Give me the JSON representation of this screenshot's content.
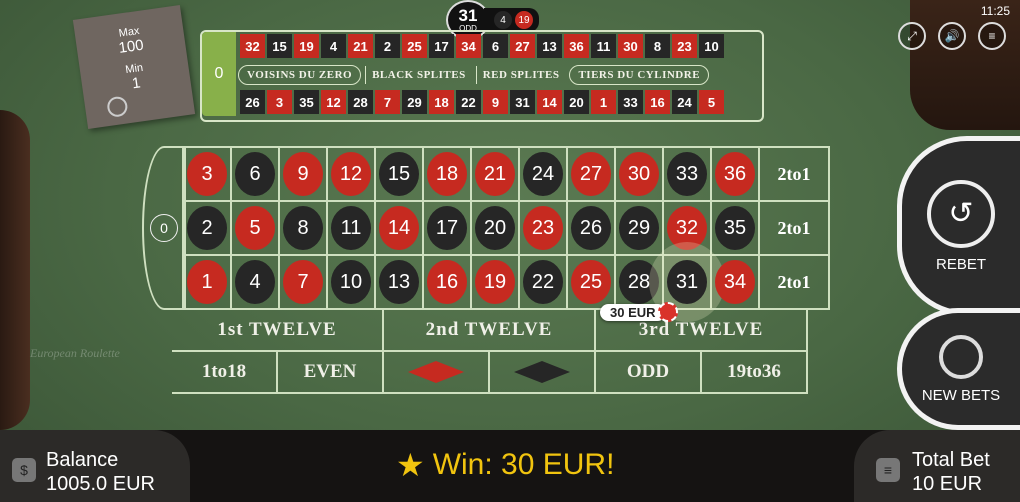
{
  "clock": "11:25",
  "limits": {
    "max_label": "Max",
    "max": "100",
    "min_label": "Min",
    "min": "1"
  },
  "last_result": {
    "number": "31",
    "parity": "ODD",
    "history": [
      {
        "n": "4",
        "c": "blk"
      },
      {
        "n": "19",
        "c": "red"
      }
    ]
  },
  "racetrack": {
    "zero": "0",
    "top": [
      {
        "n": "32",
        "c": "red"
      },
      {
        "n": "15",
        "c": "blk"
      },
      {
        "n": "19",
        "c": "red"
      },
      {
        "n": "4",
        "c": "blk"
      },
      {
        "n": "21",
        "c": "red"
      },
      {
        "n": "2",
        "c": "blk"
      },
      {
        "n": "25",
        "c": "red"
      },
      {
        "n": "17",
        "c": "blk"
      },
      {
        "n": "34",
        "c": "red"
      },
      {
        "n": "6",
        "c": "blk"
      },
      {
        "n": "27",
        "c": "red"
      },
      {
        "n": "13",
        "c": "blk"
      },
      {
        "n": "36",
        "c": "red"
      },
      {
        "n": "11",
        "c": "blk"
      },
      {
        "n": "30",
        "c": "red"
      },
      {
        "n": "8",
        "c": "blk"
      },
      {
        "n": "23",
        "c": "red"
      },
      {
        "n": "10",
        "c": "blk"
      }
    ],
    "bottom": [
      {
        "n": "26",
        "c": "blk"
      },
      {
        "n": "3",
        "c": "red"
      },
      {
        "n": "35",
        "c": "blk"
      },
      {
        "n": "12",
        "c": "red"
      },
      {
        "n": "28",
        "c": "blk"
      },
      {
        "n": "7",
        "c": "red"
      },
      {
        "n": "29",
        "c": "blk"
      },
      {
        "n": "18",
        "c": "red"
      },
      {
        "n": "22",
        "c": "blk"
      },
      {
        "n": "9",
        "c": "red"
      },
      {
        "n": "31",
        "c": "blk"
      },
      {
        "n": "14",
        "c": "red"
      },
      {
        "n": "20",
        "c": "blk"
      },
      {
        "n": "1",
        "c": "red"
      },
      {
        "n": "33",
        "c": "blk"
      },
      {
        "n": "16",
        "c": "red"
      },
      {
        "n": "24",
        "c": "blk"
      },
      {
        "n": "5",
        "c": "red"
      }
    ],
    "sections": [
      "VOISINS DU ZERO",
      "BLACK SPLITES",
      "RED SPLITES",
      "TIERS DU CYLINDRE"
    ]
  },
  "table": {
    "zero": "0",
    "rows": [
      [
        {
          "n": "3",
          "c": "red"
        },
        {
          "n": "6",
          "c": "blk"
        },
        {
          "n": "9",
          "c": "red"
        },
        {
          "n": "12",
          "c": "red"
        },
        {
          "n": "15",
          "c": "blk"
        },
        {
          "n": "18",
          "c": "red"
        },
        {
          "n": "21",
          "c": "red"
        },
        {
          "n": "24",
          "c": "blk"
        },
        {
          "n": "27",
          "c": "red"
        },
        {
          "n": "30",
          "c": "red"
        },
        {
          "n": "33",
          "c": "blk"
        },
        {
          "n": "36",
          "c": "red"
        }
      ],
      [
        {
          "n": "2",
          "c": "blk"
        },
        {
          "n": "5",
          "c": "red"
        },
        {
          "n": "8",
          "c": "blk"
        },
        {
          "n": "11",
          "c": "blk"
        },
        {
          "n": "14",
          "c": "red"
        },
        {
          "n": "17",
          "c": "blk"
        },
        {
          "n": "20",
          "c": "blk"
        },
        {
          "n": "23",
          "c": "red"
        },
        {
          "n": "26",
          "c": "blk"
        },
        {
          "n": "29",
          "c": "blk"
        },
        {
          "n": "32",
          "c": "red"
        },
        {
          "n": "35",
          "c": "blk"
        }
      ],
      [
        {
          "n": "1",
          "c": "red"
        },
        {
          "n": "4",
          "c": "blk"
        },
        {
          "n": "7",
          "c": "red"
        },
        {
          "n": "10",
          "c": "blk"
        },
        {
          "n": "13",
          "c": "blk"
        },
        {
          "n": "16",
          "c": "red"
        },
        {
          "n": "19",
          "c": "red"
        },
        {
          "n": "22",
          "c": "blk"
        },
        {
          "n": "25",
          "c": "red"
        },
        {
          "n": "28",
          "c": "blk"
        },
        {
          "n": "31",
          "c": "blk",
          "hl": true
        },
        {
          "n": "34",
          "c": "red"
        }
      ]
    ],
    "column_bet": "2to1",
    "dozens": [
      "1st TWELVE",
      "2nd TWELVE",
      "3rd TWELVE"
    ],
    "outside": {
      "low": "1to18",
      "even": "EVEN",
      "odd": "ODD",
      "high": "19to36"
    },
    "watermark": "European Roulette"
  },
  "bet_chip": {
    "label": "30 EUR"
  },
  "buttons": {
    "rebet": "REBET",
    "new_bets": "NEW BETS"
  },
  "footer": {
    "balance_label": "Balance",
    "balance_value": "1005.0 EUR",
    "win_text": "Win: 30 EUR!",
    "total_label": "Total Bet",
    "total_value": "10 EUR"
  },
  "colors": {
    "red": "#c62a20",
    "black": "#262626",
    "felt": "#4a6844",
    "zero": "#88b04a",
    "win": "#f1c40f"
  }
}
